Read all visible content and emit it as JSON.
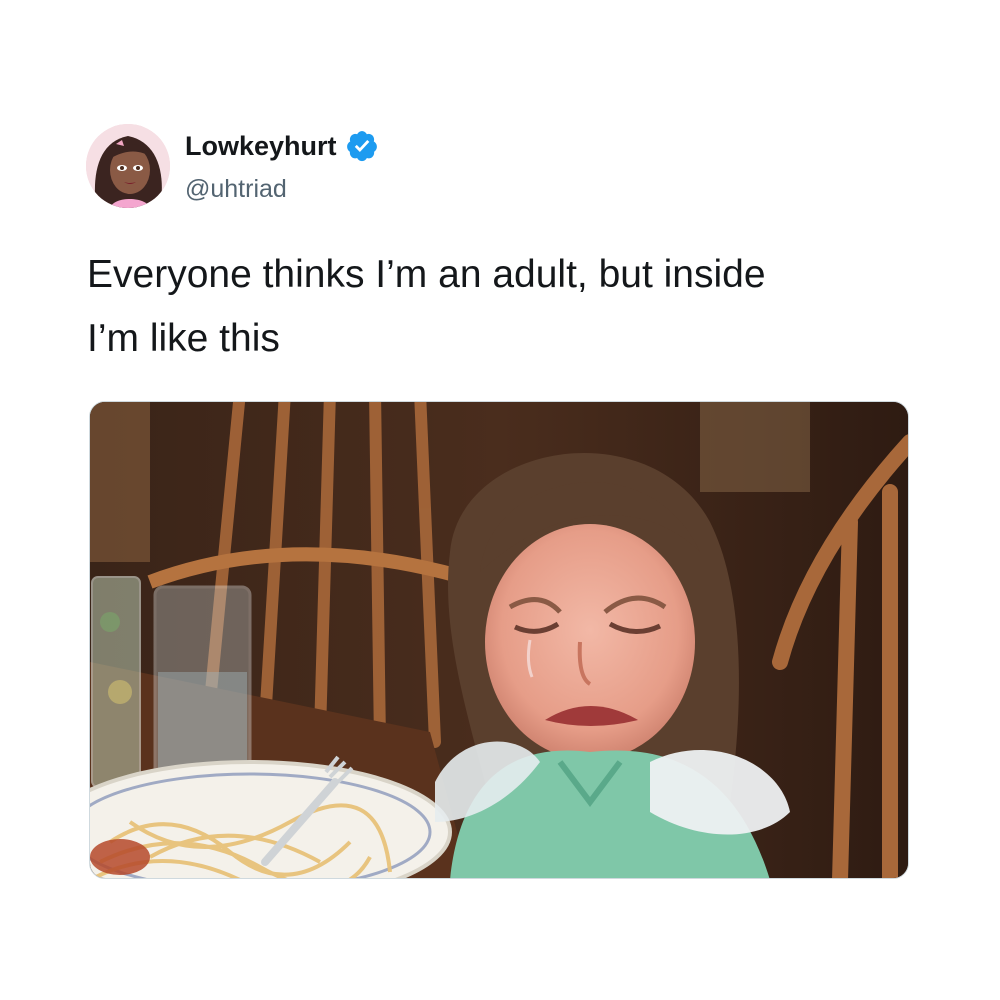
{
  "tweet": {
    "display_name": "Lowkeyhurt",
    "handle": "@uhtriad",
    "verified": true,
    "verified_icon": "verified-badge-icon",
    "text_lines": [
      "Everyone thinks I’m an adult, but inside",
      "I’m like this"
    ],
    "avatar_icon": "cartoon-avatar",
    "media_description_icon": "photo-crying-girl-at-dinner-table"
  },
  "colors": {
    "text_primary": "#14171a",
    "text_secondary": "#536471",
    "verified_blue": "#1d9bf0",
    "background": "#ffffff"
  }
}
